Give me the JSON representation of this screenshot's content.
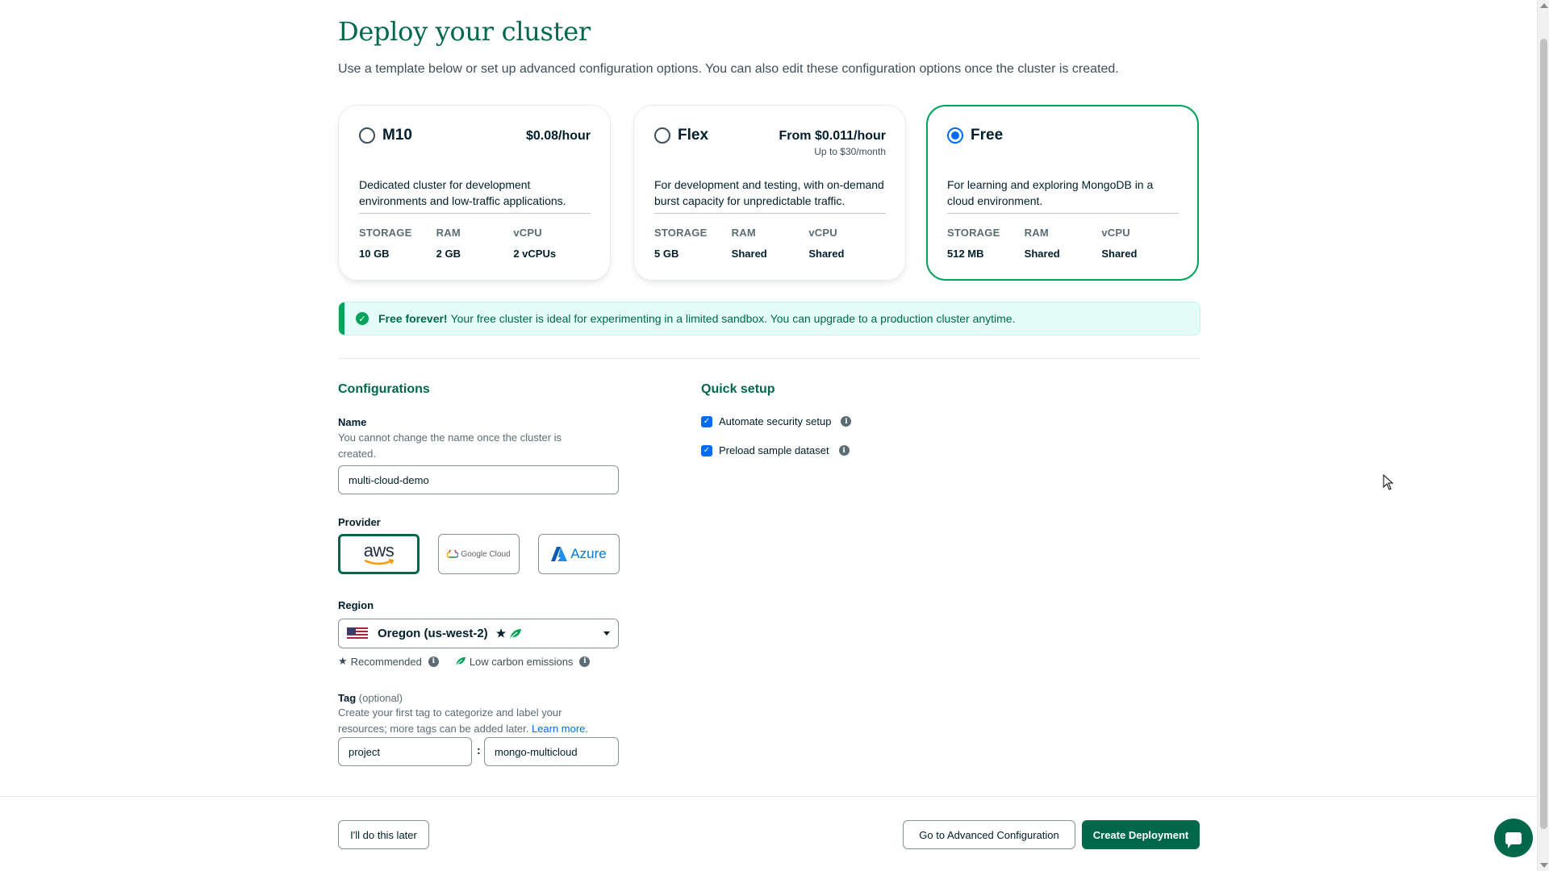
{
  "header": {
    "title": "Deploy your cluster",
    "subtitle": "Use a template below or set up advanced configuration options. You can also edit these configuration options once the cluster is created."
  },
  "tiers": [
    {
      "name": "M10",
      "price": "$0.08/hour",
      "price_sub": "",
      "description": "Dedicated cluster for development environments and low-traffic applications.",
      "storage_label": "STORAGE",
      "storage": "10 GB",
      "ram_label": "RAM",
      "ram": "2 GB",
      "vcpu_label": "vCPU",
      "vcpu": "2 vCPUs",
      "selected": false
    },
    {
      "name": "Flex",
      "price": "From $0.011/hour",
      "price_sub": "Up to $30/month",
      "description": "For development and testing, with on-demand burst capacity for unpredictable traffic.",
      "storage_label": "STORAGE",
      "storage": "5 GB",
      "ram_label": "RAM",
      "ram": "Shared",
      "vcpu_label": "vCPU",
      "vcpu": "Shared",
      "selected": false
    },
    {
      "name": "Free",
      "price": "",
      "price_sub": "",
      "description": "For learning and exploring MongoDB in a cloud environment.",
      "storage_label": "STORAGE",
      "storage": "512 MB",
      "ram_label": "RAM",
      "ram": "Shared",
      "vcpu_label": "vCPU",
      "vcpu": "Shared",
      "selected": true
    }
  ],
  "banner": {
    "bold": "Free forever!",
    "text": "Your free cluster is ideal for experimenting in a limited sandbox. You can upgrade to a production cluster anytime."
  },
  "config": {
    "heading": "Configurations",
    "name_label": "Name",
    "name_hint": "You cannot change the name once the cluster is created.",
    "name_value": "multi-cloud-demo",
    "provider_label": "Provider",
    "providers": [
      {
        "label": "aws",
        "selected": true
      },
      {
        "label": "Google Cloud",
        "selected": false
      },
      {
        "label": "Azure",
        "selected": false
      }
    ],
    "region_label": "Region",
    "region_value": "Oregon (us-west-2)",
    "recommended": "Recommended",
    "low_carbon": "Low carbon emissions",
    "tag_label": "Tag",
    "tag_optional": "(optional)",
    "tag_hint": "Create your first tag to categorize and label your resources; more tags can be added later.",
    "learn_more": "Learn more.",
    "tag_key": "project",
    "tag_sep": ":",
    "tag_value": "mongo-multicloud"
  },
  "quick_setup": {
    "heading": "Quick setup",
    "items": [
      {
        "label": "Automate security setup",
        "checked": true
      },
      {
        "label": "Preload sample dataset",
        "checked": true
      }
    ]
  },
  "footer": {
    "later": "I'll do this later",
    "advanced": "Go to Advanced Configuration",
    "create": "Create Deployment"
  },
  "colors": {
    "brand_green": "#00684a",
    "accent_green": "#00a35c",
    "link_blue": "#016bf8",
    "banner_bg": "#e3fcf7"
  }
}
